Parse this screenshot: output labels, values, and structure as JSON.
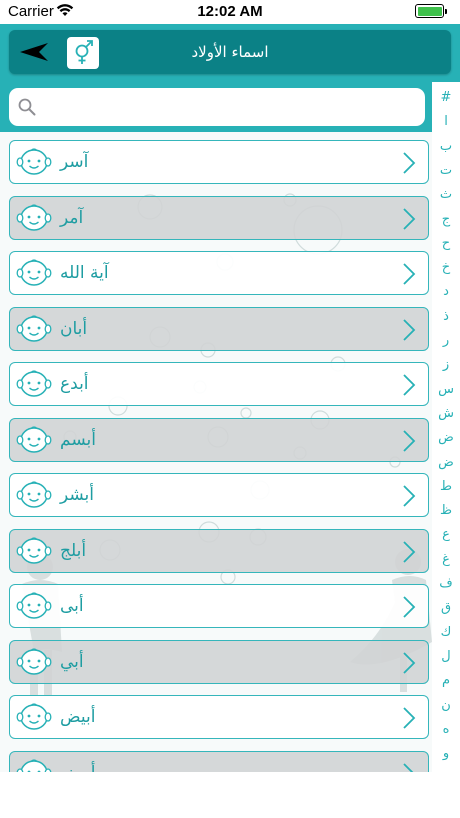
{
  "status_bar": {
    "carrier": "Carrier",
    "time": "12:02 AM",
    "battery_level": 1.0
  },
  "nav": {
    "title": "اسماء الأولاد",
    "back_icon": "back-arrow-icon",
    "gender_icon": "gender-symbol-icon"
  },
  "search": {
    "placeholder": "",
    "value": ""
  },
  "index_letters": [
    "#",
    "ا",
    "ب",
    "ت",
    "ث",
    "ج",
    "ح",
    "خ",
    "د",
    "ذ",
    "ر",
    "ز",
    "س",
    "ش",
    "ض",
    "ض",
    "ط",
    "ظ",
    "ع",
    "غ",
    "ف",
    "ق",
    "ك",
    "ل",
    "م",
    "ن",
    "ه",
    "و"
  ],
  "names": [
    {
      "name": "آسر",
      "shaded": false
    },
    {
      "name": "آمر",
      "shaded": true
    },
    {
      "name": "آية الله",
      "shaded": false
    },
    {
      "name": "أبان",
      "shaded": true
    },
    {
      "name": "أبدع",
      "shaded": false
    },
    {
      "name": "أبسم",
      "shaded": true
    },
    {
      "name": "أبشر",
      "shaded": false
    },
    {
      "name": "أبلج",
      "shaded": true
    },
    {
      "name": "أبى",
      "shaded": false
    },
    {
      "name": "أبي",
      "shaded": true
    },
    {
      "name": "أبيض",
      "shaded": false
    },
    {
      "name": "أبيض",
      "shaded": true
    }
  ],
  "colors": {
    "accent": "#27b1b6",
    "nav_dark": "#0b8186",
    "text": "#1e9da2"
  }
}
